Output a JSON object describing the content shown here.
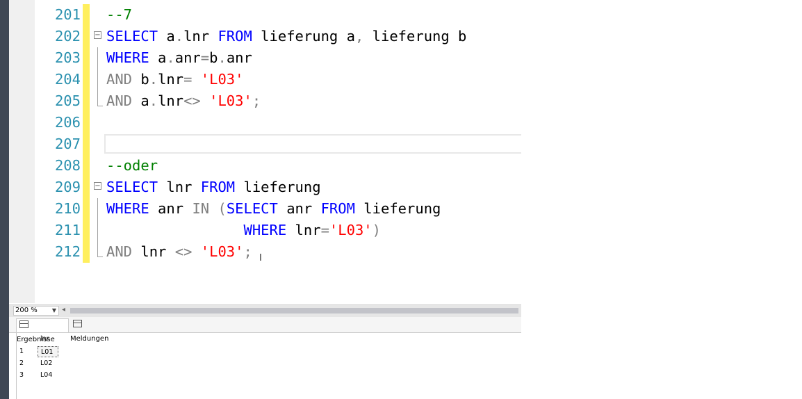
{
  "editor": {
    "lines": [
      {
        "num": "201",
        "tokens": [
          {
            "t": "--7",
            "c": "cm"
          }
        ]
      },
      {
        "num": "202",
        "fold": "minus",
        "tokens": [
          {
            "t": "SELECT",
            "c": "kw"
          },
          {
            "t": " a",
            "c": "tx"
          },
          {
            "t": ".",
            "c": "gr"
          },
          {
            "t": "lnr ",
            "c": "tx"
          },
          {
            "t": "FROM",
            "c": "kw"
          },
          {
            "t": " lieferung a",
            "c": "tx"
          },
          {
            "t": ",",
            "c": "gr"
          },
          {
            "t": " lieferung b",
            "c": "tx"
          }
        ]
      },
      {
        "num": "203",
        "tokens": [
          {
            "t": "WHERE",
            "c": "kw"
          },
          {
            "t": " a",
            "c": "tx"
          },
          {
            "t": ".",
            "c": "gr"
          },
          {
            "t": "anr",
            "c": "tx"
          },
          {
            "t": "=",
            "c": "gr"
          },
          {
            "t": "b",
            "c": "tx"
          },
          {
            "t": ".",
            "c": "gr"
          },
          {
            "t": "anr",
            "c": "tx"
          }
        ]
      },
      {
        "num": "204",
        "tokens": [
          {
            "t": "AND",
            "c": "gr"
          },
          {
            "t": " b",
            "c": "tx"
          },
          {
            "t": ".",
            "c": "gr"
          },
          {
            "t": "lnr",
            "c": "tx"
          },
          {
            "t": "= ",
            "c": "gr"
          },
          {
            "t": "'L03'",
            "c": "str"
          }
        ]
      },
      {
        "num": "205",
        "foldend": true,
        "tokens": [
          {
            "t": "AND",
            "c": "gr"
          },
          {
            "t": " a",
            "c": "tx"
          },
          {
            "t": ".",
            "c": "gr"
          },
          {
            "t": "lnr",
            "c": "tx"
          },
          {
            "t": "<> ",
            "c": "gr"
          },
          {
            "t": "'L03'",
            "c": "str"
          },
          {
            "t": ";",
            "c": "gr"
          }
        ]
      },
      {
        "num": "206",
        "tokens": []
      },
      {
        "num": "207",
        "tokens": []
      },
      {
        "num": "208",
        "tokens": [
          {
            "t": "--oder",
            "c": "cm"
          }
        ]
      },
      {
        "num": "209",
        "fold": "minus",
        "tokens": [
          {
            "t": "SELECT",
            "c": "kw"
          },
          {
            "t": " lnr ",
            "c": "tx"
          },
          {
            "t": "FROM",
            "c": "kw"
          },
          {
            "t": " lieferung",
            "c": "tx"
          }
        ]
      },
      {
        "num": "210",
        "tokens": [
          {
            "t": "WHERE",
            "c": "kw"
          },
          {
            "t": " anr ",
            "c": "tx"
          },
          {
            "t": "IN",
            "c": "gr"
          },
          {
            "t": " (",
            "c": "gr"
          },
          {
            "t": "SELECT",
            "c": "kw"
          },
          {
            "t": " anr ",
            "c": "tx"
          },
          {
            "t": "FROM",
            "c": "kw"
          },
          {
            "t": " lieferung",
            "c": "tx"
          }
        ]
      },
      {
        "num": "211",
        "tokens": [
          {
            "t": "                ",
            "c": "tx"
          },
          {
            "t": "WHERE",
            "c": "kw"
          },
          {
            "t": " lnr",
            "c": "tx"
          },
          {
            "t": "=",
            "c": "gr"
          },
          {
            "t": "'L03'",
            "c": "str"
          },
          {
            "t": ")",
            "c": "gr"
          }
        ]
      },
      {
        "num": "212",
        "foldend": true,
        "tokens": [
          {
            "t": "AND",
            "c": "gr"
          },
          {
            "t": " lnr ",
            "c": "tx"
          },
          {
            "t": "<>",
            "c": "gr"
          },
          {
            "t": " ",
            "c": "tx"
          },
          {
            "t": "'L03'",
            "c": "str"
          },
          {
            "t": ";",
            "c": "gr"
          }
        ]
      }
    ]
  },
  "statusbar": {
    "zoom": "200 %"
  },
  "results": {
    "tabs": [
      {
        "label": "Ergebnisse",
        "active": true
      },
      {
        "label": "Meldungen",
        "active": false
      }
    ],
    "columns": [
      "lnr"
    ],
    "rows": [
      {
        "n": "1",
        "lnr": "L01"
      },
      {
        "n": "2",
        "lnr": "L02"
      },
      {
        "n": "3",
        "lnr": "L04"
      }
    ]
  }
}
